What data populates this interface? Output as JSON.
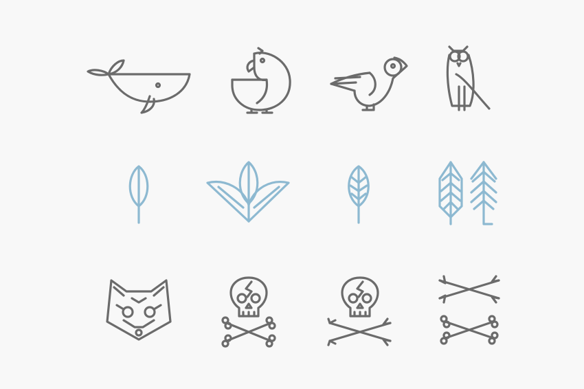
{
  "colors": {
    "background": "#f8f8f8",
    "outline_gray": "#6b6b6b",
    "outline_blue": "#8db9d1"
  },
  "icon_rows": [
    {
      "color": "gray",
      "icons": [
        "whale-icon",
        "parrot-icon",
        "bird-icon",
        "owl-icon"
      ]
    },
    {
      "color": "blue",
      "icons": [
        "leaf-icon",
        "three-leaves-icon",
        "leaf-veined-icon",
        "pine-trees-icon"
      ]
    },
    {
      "color": "gray",
      "icons": [
        "fox-icon",
        "skull-crossbones-icon",
        "skull-crossed-arrows-icon",
        "crossed-arrows-bones-icon"
      ]
    }
  ]
}
